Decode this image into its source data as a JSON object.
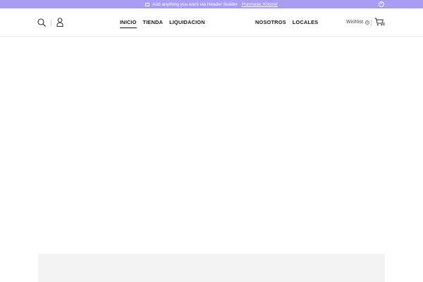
{
  "topbar": {
    "promo_icon": "envelope-icon",
    "promo_text": "Add anything you want via Header Builder",
    "promo_link": "Purchase XStore!",
    "close_icon": "close-icon",
    "background_color": "#a99cf3"
  },
  "header": {
    "search_icon": "search-icon",
    "account_icon": "user-icon",
    "nav_left": [
      {
        "label": "INICIO",
        "active": true
      },
      {
        "label": "TIENDA",
        "active": false
      },
      {
        "label": "LIQUIDACION",
        "active": false
      }
    ],
    "nav_right": [
      {
        "label": "NOSOTROS"
      },
      {
        "label": "LOCALES"
      }
    ],
    "wishlist_label": "Wishlist",
    "wishlist_count": "0",
    "cart_icon": "cart-icon",
    "cart_count": "0"
  }
}
